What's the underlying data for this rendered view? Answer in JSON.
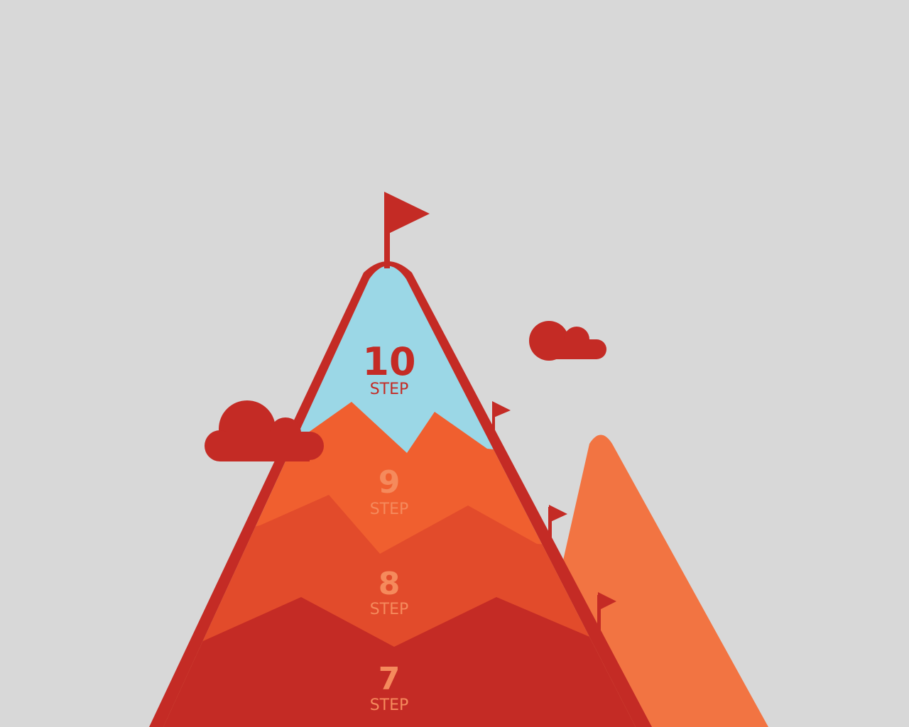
{
  "colors": {
    "background": "#d8d8d8",
    "brand_red": "#c42b25",
    "sky_blue": "#9bd7e6",
    "band_9": "#f05f2f",
    "band_8": "#e24b2b",
    "band_7": "#c42b25",
    "back_mountain": "#f27442",
    "label_light": "#f58a5c",
    "label_dark": "#c42b25"
  },
  "steps": [
    {
      "number": "10",
      "label": "STEP"
    },
    {
      "number": "9",
      "label": "STEP"
    },
    {
      "number": "8",
      "label": "STEP"
    },
    {
      "number": "7",
      "label": "STEP"
    }
  ],
  "icons": {
    "summit_flag": "flag-icon",
    "side_flags": "flag-icon",
    "clouds": "cloud-icon"
  }
}
